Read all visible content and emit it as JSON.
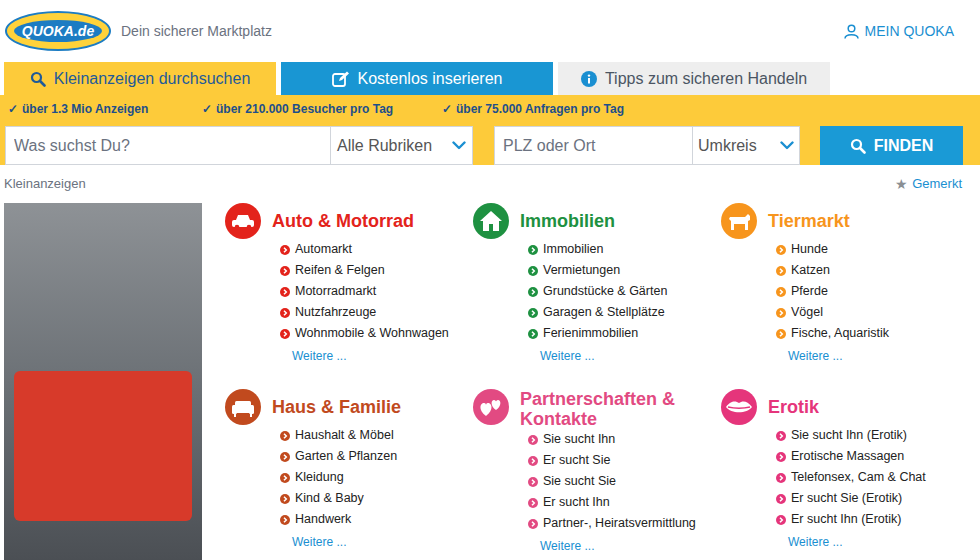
{
  "header": {
    "logo": "QUOKA.de",
    "tagline": "Dein sicherer Marktplatz",
    "account": "MEIN QUOKA"
  },
  "tabs": [
    {
      "label": "Kleinanzeigen durchsuchen",
      "selected": true,
      "kind": "search"
    },
    {
      "label": "Kostenlos inserieren",
      "selected": false,
      "kind": "cta"
    },
    {
      "label": "Tipps zum sicheren Handeln",
      "selected": false,
      "kind": "info"
    }
  ],
  "stats": [
    {
      "icon": "✓",
      "text": "über 1.3 Mio Anzeigen"
    },
    {
      "icon": "✓",
      "text": "über 210.000 Besucher pro Tag"
    },
    {
      "icon": "✓",
      "text": "über 75.000 Anfragen pro Tag"
    }
  ],
  "search": {
    "query_placeholder": "Was suchst Du?",
    "category": "Alle Rubriken",
    "location_placeholder": "PLZ oder Ort",
    "radius": "Umkreis",
    "button": "FINDEN"
  },
  "breadcrumb": "Kleinanzeigen",
  "bookmarks": {
    "icon": "★",
    "label": "Gemerkt"
  },
  "categories": [
    {
      "title": "Auto & Motorrad",
      "color": "#e3231b",
      "items": [
        "Automarkt",
        "Reifen & Felgen",
        "Motorradmarkt",
        "Nutzfahrzeuge",
        "Wohnmobile & Wohnwagen"
      ],
      "more": "Weitere ..."
    },
    {
      "title": "Immobilien",
      "color": "#1e9141",
      "items": [
        "Immobilien",
        "Vermietungen",
        "Grundstücke & Gärten",
        "Garagen & Stellplätze",
        "Ferienimmobilien"
      ],
      "more": "Weitere ..."
    },
    {
      "title": "Tiermarkt",
      "color": "#f7951d",
      "items": [
        "Hunde",
        "Katzen",
        "Pferde",
        "Vögel",
        "Fische, Aquaristik"
      ],
      "more": "Weitere ..."
    },
    {
      "title": "Haus & Familie",
      "color": "#c14a1e",
      "items": [
        "Haushalt & Möbel",
        "Garten & Pflanzen",
        "Kleidung",
        "Kind & Baby",
        "Handwerk"
      ],
      "more": "Weitere ..."
    },
    {
      "title": "Partnerschaften & Kontakte",
      "color": "#e24a82",
      "items": [
        "Sie sucht Ihn",
        "Er sucht Sie",
        "Sie sucht Sie",
        "Er sucht Ihn",
        "Partner-, Heiratsvermittlung"
      ],
      "more": "Weitere ..."
    },
    {
      "title": "Erotik",
      "color": "#e5357b",
      "items": [
        "Sie sucht Ihn (Erotik)",
        "Erotische Massagen",
        "Telefonsex, Cam & Chat",
        "Er sucht Sie (Erotik)",
        "Er sucht Ihn (Erotik)"
      ],
      "more": "Weitere ..."
    }
  ]
}
